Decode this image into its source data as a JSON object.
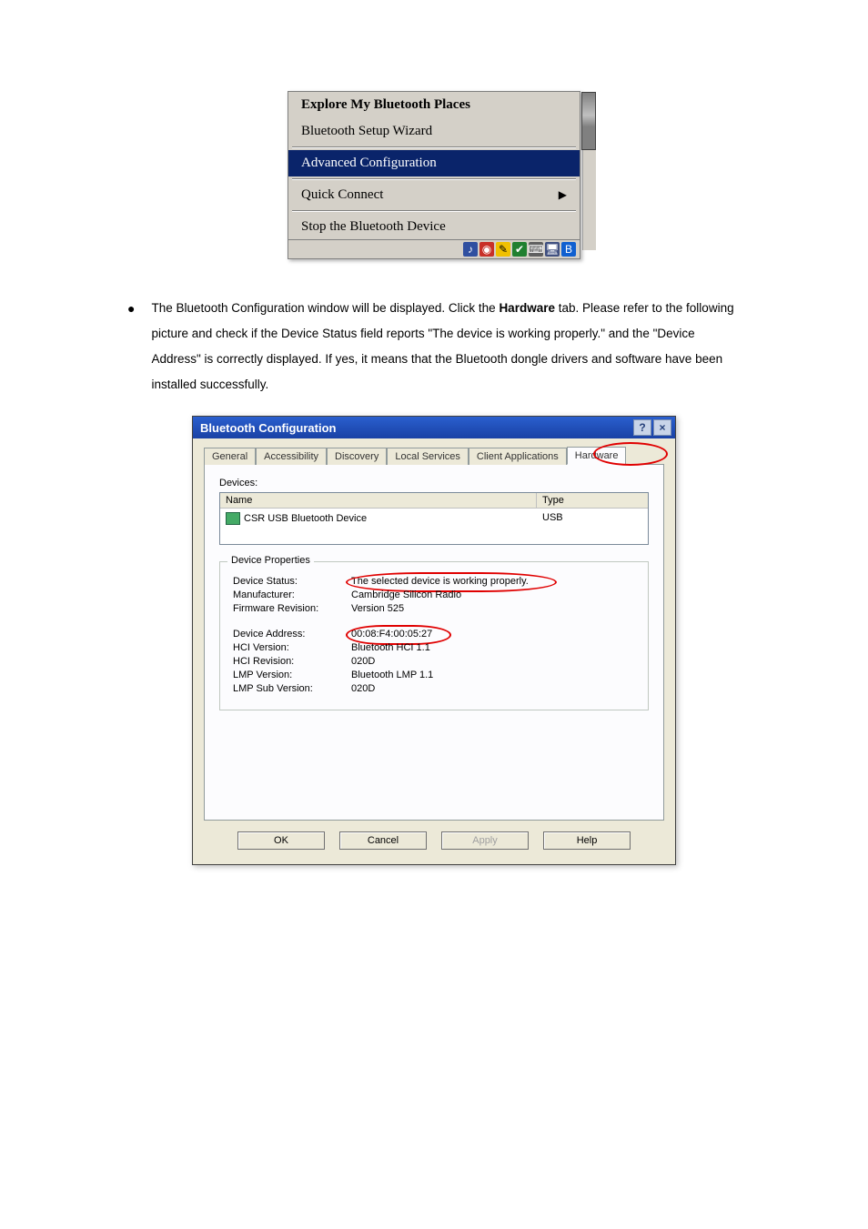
{
  "context_menu": {
    "explore": "Explore My Bluetooth Places",
    "wizard": "Bluetooth Setup Wizard",
    "advanced": "Advanced Configuration",
    "quick_connect": "Quick Connect",
    "stop": "Stop the Bluetooth Device"
  },
  "paragraph": {
    "pre": "The Bluetooth Configuration window will be displayed. Click the ",
    "bold": "Hardware",
    "post": " tab. Please refer to the following picture and check if the Device Status field reports \"The device is working properly.\" and the \"Device Address\" is correctly displayed. If yes, it means that the Bluetooth dongle drivers and software have been installed successfully."
  },
  "dialog": {
    "title": "Bluetooth Configuration",
    "help_btn": "?",
    "close_btn": "×",
    "tabs": {
      "general": "General",
      "accessibility": "Accessibility",
      "discovery": "Discovery",
      "local_services": "Local Services",
      "client_apps": "Client Applications",
      "hardware": "Hardware"
    },
    "devices_label": "Devices:",
    "col_name": "Name",
    "col_type": "Type",
    "device_name": "CSR USB Bluetooth Device",
    "device_type": "USB",
    "props_legend": "Device Properties",
    "props": {
      "status_label": "Device Status:",
      "status_value": "The selected device is working properly.",
      "manufacturer_label": "Manufacturer:",
      "manufacturer_value": "Cambridge Silicon Radio",
      "firmware_label": "Firmware Revision:",
      "firmware_value": "Version 525",
      "address_label": "Device Address:",
      "address_value": "00:08:F4:00:05:27",
      "hci_ver_label": "HCI Version:",
      "hci_ver_value": "Bluetooth HCI 1.1",
      "hci_rev_label": "HCI Revision:",
      "hci_rev_value": "020D",
      "lmp_ver_label": "LMP Version:",
      "lmp_ver_value": "Bluetooth LMP 1.1",
      "lmp_sub_label": "LMP Sub Version:",
      "lmp_sub_value": "020D"
    },
    "buttons": {
      "ok": "OK",
      "cancel": "Cancel",
      "apply": "Apply",
      "help": "Help"
    }
  }
}
